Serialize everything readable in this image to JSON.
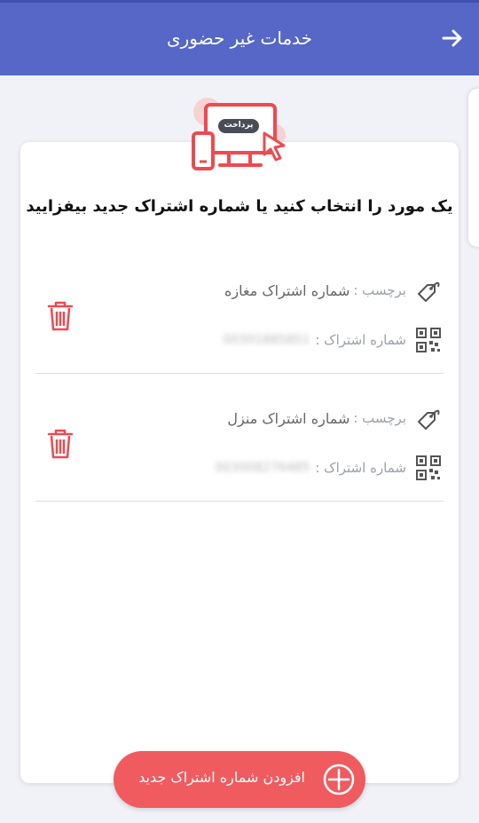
{
  "header": {
    "title": "خدمات غیر حضوری",
    "back_icon": "arrow-right-icon"
  },
  "illustration": {
    "badge_text": "پرداخت",
    "icon": "payment-devices-illustration"
  },
  "instruction": "یک مورد را انتخاب کنید یا شماره اشتراک جدید بیفزایید",
  "subscriptions": [
    {
      "label_key": "برچسب :",
      "label_value": "شماره اشتراک مغازه",
      "number_key": "شماره اشتراک :",
      "number_value": "00301885851"
    },
    {
      "label_key": "برچسب :",
      "label_value": "شماره اشتراک منزل",
      "number_key": "شماره اشتراک :",
      "number_value": "003008276485"
    }
  ],
  "add_button": {
    "label": "افزودن شماره اشتراک جدید",
    "icon": "plus-circle-icon"
  },
  "colors": {
    "header": "#5667c7",
    "accent_red": "#ef5b5f",
    "background": "#f1f2f7"
  }
}
